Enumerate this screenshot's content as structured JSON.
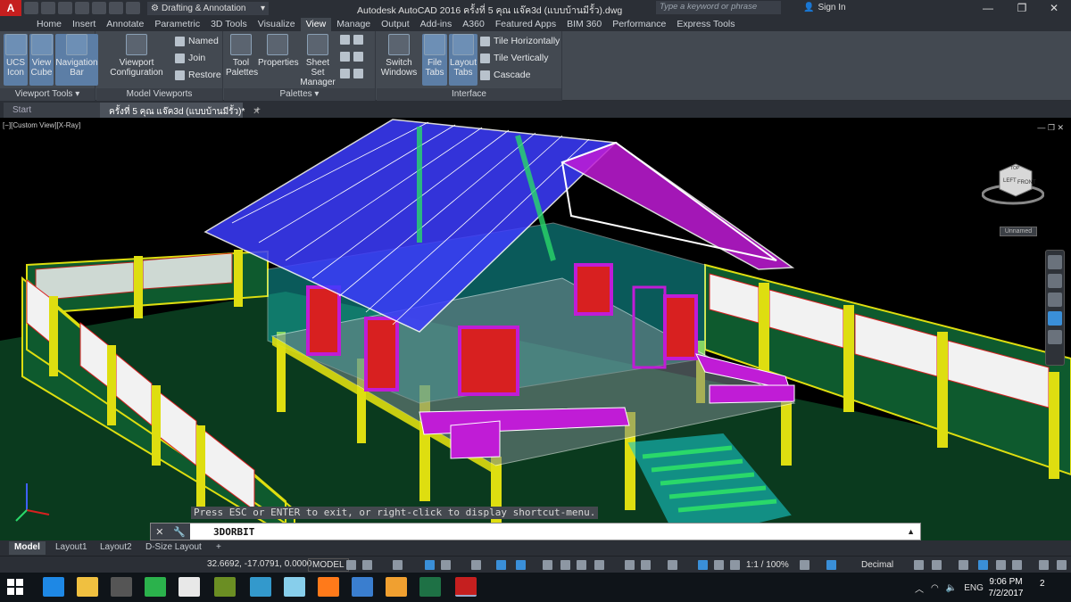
{
  "titlebar": {
    "logo": "A",
    "workspace": "Drafting & Annotation",
    "title": "Autodesk AutoCAD 2016   ครั้งที่ 5 คุณ แจ๊ค3d (แบบบ้านมีรั้ว).dwg",
    "search_placeholder": "Type a keyword or phrase",
    "signin": "Sign In"
  },
  "ribbon_tabs": [
    "Home",
    "Insert",
    "Annotate",
    "Parametric",
    "3D Tools",
    "Visualize",
    "View",
    "Manage",
    "Output",
    "Add-ins",
    "A360",
    "Featured Apps",
    "BIM 360",
    "Performance",
    "Express Tools"
  ],
  "active_tab": "View",
  "ribbon": {
    "viewport_tools": {
      "label": "Viewport Tools",
      "ucs_icon": "UCS Icon",
      "view_cube": "View Cube",
      "navigation_bar": "Navigation Bar"
    },
    "model_viewports": {
      "label": "Model Viewports",
      "viewport_configuration": "Viewport Configuration",
      "named": "Named",
      "join": "Join",
      "restore": "Restore"
    },
    "palettes": {
      "label": "Palettes",
      "tool_palettes": "Tool Palettes",
      "properties": "Properties",
      "sheet_set_manager": "Sheet Set Manager"
    },
    "interface": {
      "label": "Interface",
      "switch_windows": "Switch Windows",
      "file_tabs": "File Tabs",
      "layout_tabs": "Layout Tabs",
      "tile_horizontally": "Tile Horizontally",
      "tile_vertically": "Tile Vertically",
      "cascade": "Cascade"
    }
  },
  "file_tabs": {
    "start": "Start",
    "drawing": "ครั้งที่ 5 คุณ แจ๊ค3d (แบบบ้านมีรั้ว)*"
  },
  "viewport": {
    "label": "[−][Custom View][X-Ray]",
    "viewcube_top": "TOP",
    "viewcube_front": "FRONT",
    "viewcube_left": "LEFT",
    "unnamed": "Unnamed"
  },
  "prompt_hint": "Press ESC or ENTER to exit, or right-click to display shortcut-menu.",
  "command": "3DORBIT",
  "layout_tabs": [
    "Model",
    "Layout1",
    "Layout2",
    "D-Size Layout"
  ],
  "status": {
    "coords": "32.6692, -17.0791, 0.0000",
    "model": "MODEL",
    "scale": "1:1 / 100%",
    "units": "Decimal"
  },
  "taskbar": {
    "language": "ENG",
    "time": "9:06 PM",
    "date": "7/2/2017",
    "notifications": "2"
  },
  "colors": {
    "roof_blue": "#3c3cff",
    "purple": "#c01cd6",
    "yellow": "#dede10",
    "cyan": "#18c8c8",
    "green": "#0a5a28",
    "red_shutter": "#d82020"
  }
}
